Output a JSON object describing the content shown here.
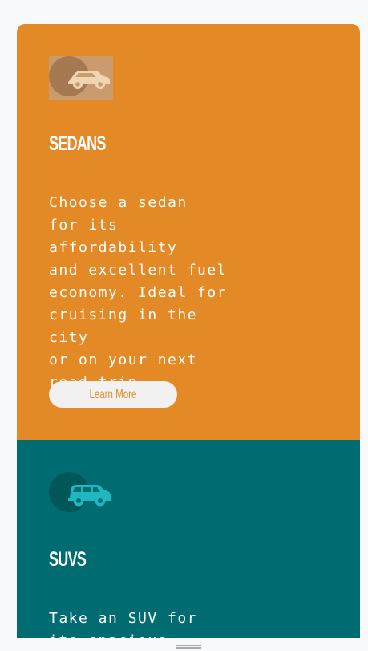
{
  "colors": {
    "page_background": "#f8f9fa",
    "sedan_card": "#e38a27",
    "suv_card": "#006c71",
    "button_background": "#f1f1f1"
  },
  "cards": [
    {
      "icon": "sedan-car-icon",
      "title": "SEDANS",
      "description": "Choose a sedan\nfor its affordability\nand excellent fuel\neconomy. Ideal for\ncruising in the city\nor on your next\nroad trip.",
      "button_label": "Learn More"
    },
    {
      "icon": "suv-car-icon",
      "title": "SUVS",
      "description": "Take an SUV for\nits spacious"
    }
  ]
}
